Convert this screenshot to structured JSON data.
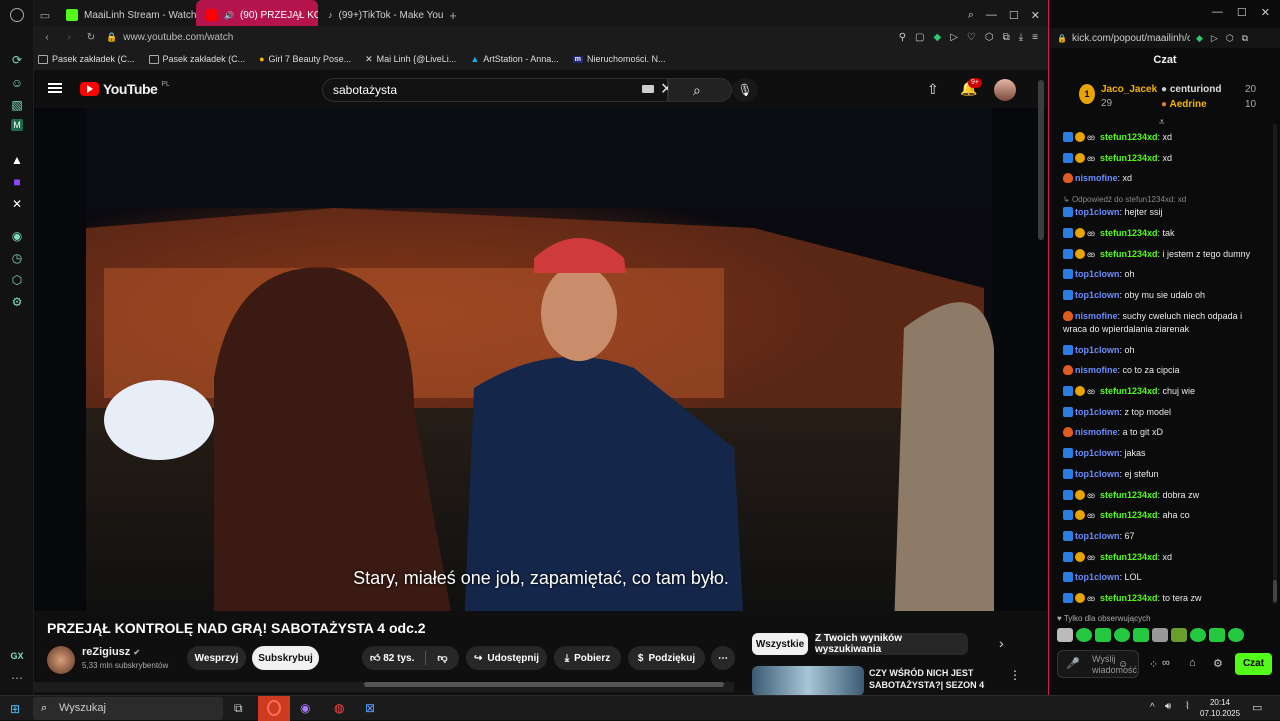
{
  "browser": {
    "tabs": [
      {
        "label": "MaaiLinh Stream - Watch",
        "favicon_color": "#53fc18"
      },
      {
        "label": "(90) PRZEJĄŁ KONTRO",
        "favicon_color": "#ff0000"
      },
      {
        "label": "(99+)TikTok - Make Your",
        "favicon_color": "#ffffff"
      }
    ],
    "address": "www.youtube.com/watch",
    "bookmarks": [
      "Pasek zakładek (C...",
      "Pasek zakładek (C...",
      "Girl 7 Beauty Pose...",
      "Mai Linh {@LiveLi...",
      "ArtStation - Anna...",
      "Nieruchomości. N..."
    ]
  },
  "youtube": {
    "logo": "YouTube",
    "region": "PL",
    "search_value": "sabotażysta",
    "notifications_count": "9+",
    "subtitle": "Stary, miałeś one job, zapamiętać, co tam było.",
    "video_title": "PRZEJĄŁ KONTROLĘ NAD GRĄ! SABOTAŻYSTA 4 odc.2",
    "channel_name": "reZigiusz",
    "subscribers": "5,33 mln subskrybentów",
    "buttons": {
      "support": "Wesprzyj",
      "subscribe": "Subskrybuj",
      "likes": "82 tys.",
      "share": "Udostępnij",
      "download": "Pobierz",
      "thanks": "Podziękuj"
    },
    "filters": [
      "Wszystkie",
      "Z Twoich wyników wyszukiwania"
    ],
    "recommendation_title": "CZY WŚRÓD NICH JEST SABOTAŻYSTA?| SEZON 4"
  },
  "chat": {
    "address": "kick.com/popout/maailinh/c",
    "title": "Czat",
    "leaderboard": [
      {
        "name": "Jaco_Jacek",
        "value": "29"
      },
      {
        "name": "centuriond",
        "value": "20"
      },
      {
        "name": "Aedrine",
        "value": "10"
      }
    ],
    "messages": [
      {
        "user": "stefun1234xd",
        "text": "xd",
        "color": "#53fc18",
        "badges": "psm"
      },
      {
        "user": "stefun1234xd",
        "text": "xd",
        "color": "#53fc18",
        "badges": "psm"
      },
      {
        "user": "nismofine",
        "text": "xd",
        "color": "#6a8cff",
        "badges": "f"
      },
      {
        "reply": "Odpowiedź do stefun1234xd: xd"
      },
      {
        "user": "top1clown",
        "text": "hejter ssij",
        "color": "#6a8cff",
        "badges": "p"
      },
      {
        "user": "stefun1234xd",
        "text": "tak",
        "color": "#53fc18",
        "badges": "psm"
      },
      {
        "user": "stefun1234xd",
        "text": "i jestem z tego dumny",
        "color": "#53fc18",
        "badges": "psm"
      },
      {
        "user": "top1clown",
        "text": "oh",
        "color": "#6a8cff",
        "badges": "p"
      },
      {
        "user": "top1clown",
        "text": "oby mu sie udalo oh",
        "color": "#6a8cff",
        "badges": "p"
      },
      {
        "user": "nismofine",
        "text": "suchy cweluch niech odpada i wraca do wpierdalania ziarenak",
        "color": "#6a8cff",
        "badges": "f"
      },
      {
        "user": "top1clown",
        "text": "oh",
        "color": "#6a8cff",
        "badges": "p"
      },
      {
        "user": "nismofine",
        "text": "co to za cipcia",
        "color": "#6a8cff",
        "badges": "f"
      },
      {
        "user": "stefun1234xd",
        "text": "chuj wie",
        "color": "#53fc18",
        "badges": "psm"
      },
      {
        "user": "top1clown",
        "text": "z top model",
        "color": "#6a8cff",
        "badges": "p"
      },
      {
        "user": "nismofine",
        "text": "a to git xD",
        "color": "#6a8cff",
        "badges": "f"
      },
      {
        "user": "top1clown",
        "text": "jakas",
        "color": "#6a8cff",
        "badges": "p"
      },
      {
        "user": "top1clown",
        "text": "ej stefun",
        "color": "#6a8cff",
        "badges": "p"
      },
      {
        "user": "stefun1234xd",
        "text": "dobra zw",
        "color": "#53fc18",
        "badges": "psm"
      },
      {
        "user": "stefun1234xd",
        "text": "aha co",
        "color": "#53fc18",
        "badges": "psm"
      },
      {
        "user": "top1clown",
        "text": "67",
        "color": "#6a8cff",
        "badges": "p"
      },
      {
        "user": "stefun1234xd",
        "text": "xd",
        "color": "#53fc18",
        "badges": "psm"
      },
      {
        "user": "top1clown",
        "text": "LOL",
        "color": "#6a8cff",
        "badges": "p"
      },
      {
        "user": "stefun1234xd",
        "text": "to tera zw",
        "color": "#53fc18",
        "badges": "psm"
      }
    ],
    "followers_only": "Tylko dla obserwujących",
    "input_placeholder": "Wyślij wiadomość",
    "send_label": "Czat"
  },
  "taskbar": {
    "search_placeholder": "Wyszukaj",
    "time": "20:14",
    "date": "07.10.2025"
  },
  "colors": {
    "accent": "#d01a52",
    "kick_green": "#53fc18",
    "yt_red": "#ff0000"
  }
}
